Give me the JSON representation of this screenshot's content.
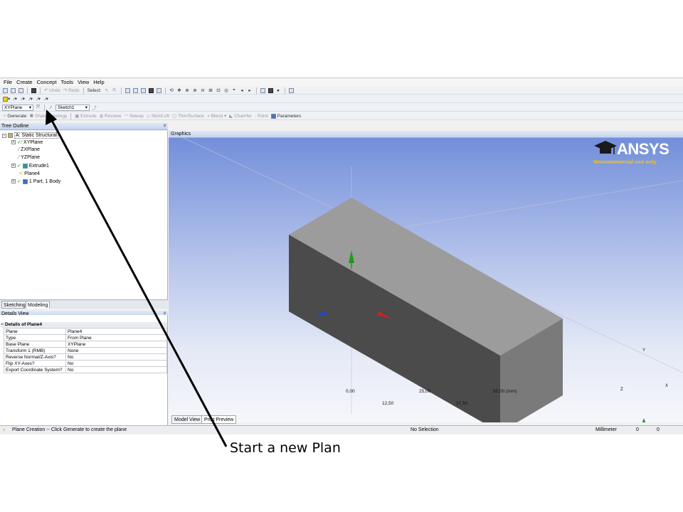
{
  "menu": [
    "File",
    "Create",
    "Concept",
    "Tools",
    "View",
    "Help"
  ],
  "toolbar1": {
    "undo": "Undo",
    "redo": "Redo",
    "select_label": "Select:"
  },
  "toolbar3": {
    "plane_select": "XYPlane",
    "sketch_select": "Sketch1"
  },
  "toolbar4": {
    "generate": "Generate",
    "share_topology": "Share Topology",
    "extrude": "Extrude",
    "revolve": "Revolve",
    "sweep": "Sweep",
    "skin_loft": "Skin/Loft",
    "thin_surface": "Thin/Surface",
    "blend": "Blend",
    "chamfer": "Chamfer",
    "point": "Point",
    "parameters": "Parameters"
  },
  "tree": {
    "title": "Tree Outline",
    "root": "A: Static Structural",
    "items": [
      "XYPlane",
      "ZXPlane",
      "YZPlane",
      "Extrude1",
      "Plane4",
      "1 Part, 1 Body"
    ]
  },
  "panel_tabs": [
    "Sketching",
    "Modeling"
  ],
  "details": {
    "title": "Details View",
    "group": "Details of Plane4",
    "rows": [
      {
        "k": "Plane",
        "v": "Plane4"
      },
      {
        "k": "Type",
        "v": "From Plane"
      },
      {
        "k": "Base Plane",
        "v": "XYPlane"
      },
      {
        "k": "Transform 1 (RMB)",
        "v": "None"
      },
      {
        "k": "Reverse Normal/Z-Axis?",
        "v": "No"
      },
      {
        "k": "Flip XY-Axes?",
        "v": "No"
      },
      {
        "k": "Export Coordinate System?",
        "v": "No"
      }
    ]
  },
  "graphics": {
    "title": "Graphics",
    "logo": "ANSYS",
    "logo_sub": "Noncommercial use only",
    "scale_top": [
      "0,00",
      "25,00",
      "50,00 (mm)"
    ],
    "scale_bottom": [
      "12,50",
      "37,50"
    ],
    "triad": {
      "x": "X",
      "y": "Y",
      "z": "Z"
    }
  },
  "view_tabs": [
    "Model View",
    "Print Preview"
  ],
  "status": {
    "message": "Plane Creation -- Click Generate to create the plane",
    "selection": "No Selection",
    "units": "Millimeter",
    "v1": "0",
    "v2": "0"
  },
  "annotation": "Start a new Plan",
  "colors": {
    "box_top": "#9a9a9a",
    "box_front": "#4a4a4a",
    "box_side": "#7c7c7c",
    "axis_x": "#d42020",
    "axis_y": "#1e9a1e",
    "axis_z": "#2346c8"
  }
}
